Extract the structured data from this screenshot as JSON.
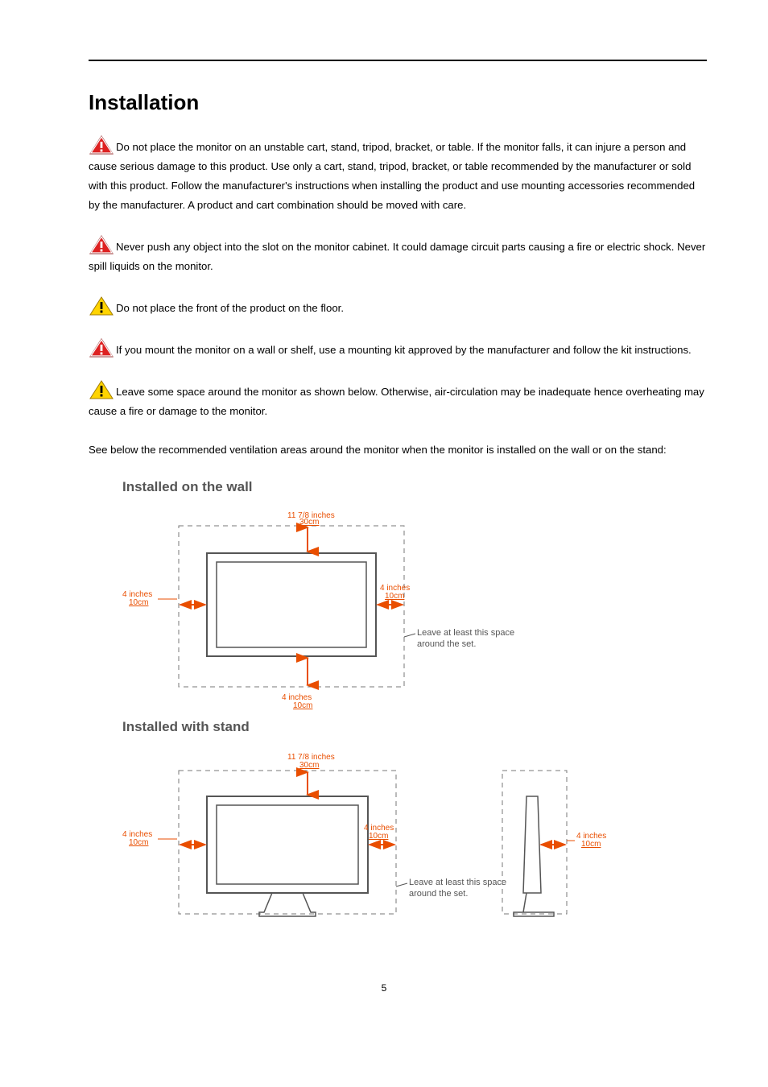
{
  "heading": "Installation",
  "paragraphs": {
    "p1": "Do not place the monitor on an unstable cart, stand, tripod, bracket, or table. If the monitor falls, it can injure a person and cause serious damage to this product. Use only a cart, stand, tripod, bracket, or table recommended by the manufacturer or sold with this product. Follow the manufacturer's instructions when installing the product and use mounting accessories recommended by the manufacturer. A product and cart combination should be moved with care.",
    "p2": "Never push any object into the slot on the monitor cabinet. It could damage circuit parts causing a fire or electric shock. Never spill liquids on the monitor.",
    "p3": "Do not place the front of the product on the floor.",
    "p4": "If you mount the monitor on a wall or shelf, use a mounting kit approved by the manufacturer and follow the kit instructions.",
    "p5": "Leave some space around the monitor as shown below. Otherwise, air-circulation may be inadequate hence overheating may cause a fire or damage to the monitor.",
    "p6": "See below the recommended ventilation areas around the monitor when the monitor is installed on the wall or on the stand:"
  },
  "diagrams": {
    "wall": {
      "title": "Installed on the wall",
      "top_in": "11 7/8 inches",
      "top_cm": "30cm",
      "side_in": "4 inches",
      "side_cm": "10cm",
      "bottom_in": "4 inches",
      "bottom_cm": "10cm",
      "note_l1": "Leave at least this space",
      "note_l2": "around the set."
    },
    "stand": {
      "title": "Installed with stand",
      "top_in": "11 7/8 inches",
      "top_cm": "30cm",
      "side_in": "4 inches",
      "side_cm": "10cm",
      "side2_in": "4 inches",
      "side2_cm": "10cm",
      "note_l1": "Leave at least this space",
      "note_l2": "around the set."
    }
  },
  "page_number": "5"
}
